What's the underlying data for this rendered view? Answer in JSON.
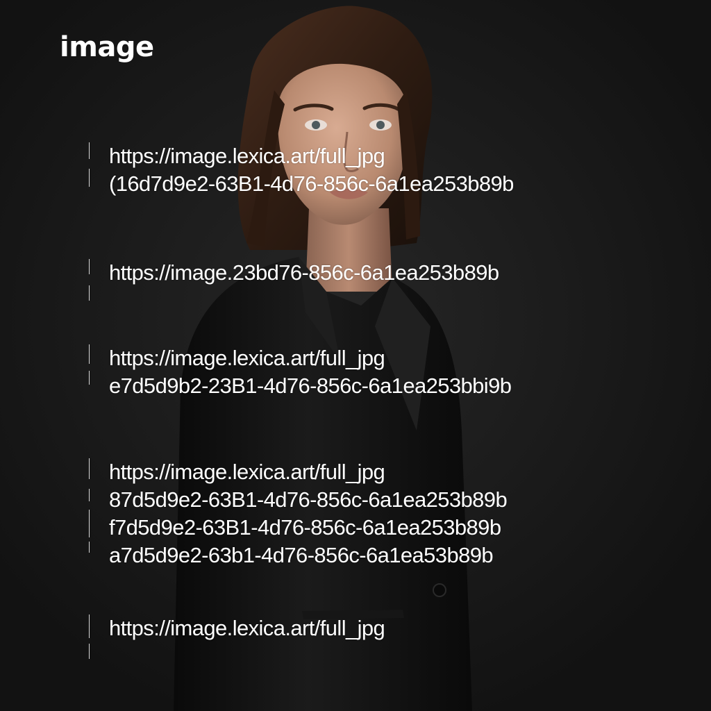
{
  "title": "image",
  "entries": [
    {
      "lines": [
        "https://image.lexica.art/full_jpg",
        "(16d7d9e2-63B1-4d76-856c-6a1ea253b89b"
      ]
    },
    {
      "lines": [
        "https://image.23bd76-856c-6a1ea253b89b"
      ]
    },
    {
      "lines": [
        "https://image.lexica.art/full_jpg",
        "e7d5d9b2-23B1-4d76-856c-6a1ea253bbi9b"
      ]
    },
    {
      "lines": [
        "https://image.lexica.art/full_jpg",
        "87d5d9e2-63B1-4d76-856c-6a1ea253b89b",
        "f7d5d9e2-63B1-4d76-856c-6a1ea253b89b",
        "a7d5d9e2-63b1-4d76-856c-6a1ea53b89b"
      ]
    },
    {
      "lines": [
        "https://image.lexica.art/full_jpg"
      ]
    }
  ],
  "colors": {
    "background": "#151515",
    "text": "#ffffff",
    "jacket": "#0c0c0c",
    "skin": "#c4967c",
    "hair": "#3a2418"
  }
}
